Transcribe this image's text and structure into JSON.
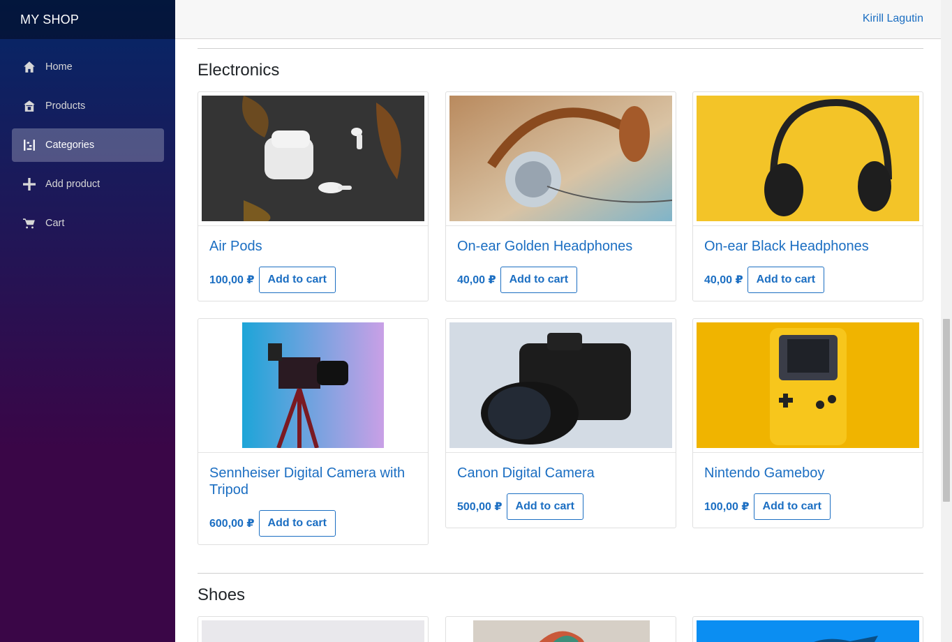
{
  "app": {
    "brand": "MY SHOP",
    "user": "Kirill Lagutin"
  },
  "nav": {
    "items": [
      {
        "label": "Home",
        "icon": "home-icon"
      },
      {
        "label": "Products",
        "icon": "store-icon"
      },
      {
        "label": "Categories",
        "icon": "categories-icon",
        "active": true
      },
      {
        "label": "Add product",
        "icon": "plus-icon"
      },
      {
        "label": "Cart",
        "icon": "cart-icon"
      }
    ]
  },
  "sections": [
    {
      "title": "Electronics",
      "products": [
        {
          "name": "Air Pods",
          "price": "100,00 ₽",
          "button": "Add to cart"
        },
        {
          "name": "On-ear Golden Headphones",
          "price": "40,00 ₽",
          "button": "Add to cart"
        },
        {
          "name": "On-ear Black Headphones",
          "price": "40,00 ₽",
          "button": "Add to cart"
        },
        {
          "name": "Sennheiser Digital Camera with Tripod",
          "price": "600,00 ₽",
          "button": "Add to cart"
        },
        {
          "name": "Canon Digital Camera",
          "price": "500,00 ₽",
          "button": "Add to cart"
        },
        {
          "name": "Nintendo Gameboy",
          "price": "100,00 ₽",
          "button": "Add to cart"
        }
      ]
    },
    {
      "title": "Shoes"
    }
  ],
  "colors": {
    "accent": "#1b6ec2",
    "sidebar_top": "#052767",
    "sidebar_bottom": "#3a0647"
  }
}
